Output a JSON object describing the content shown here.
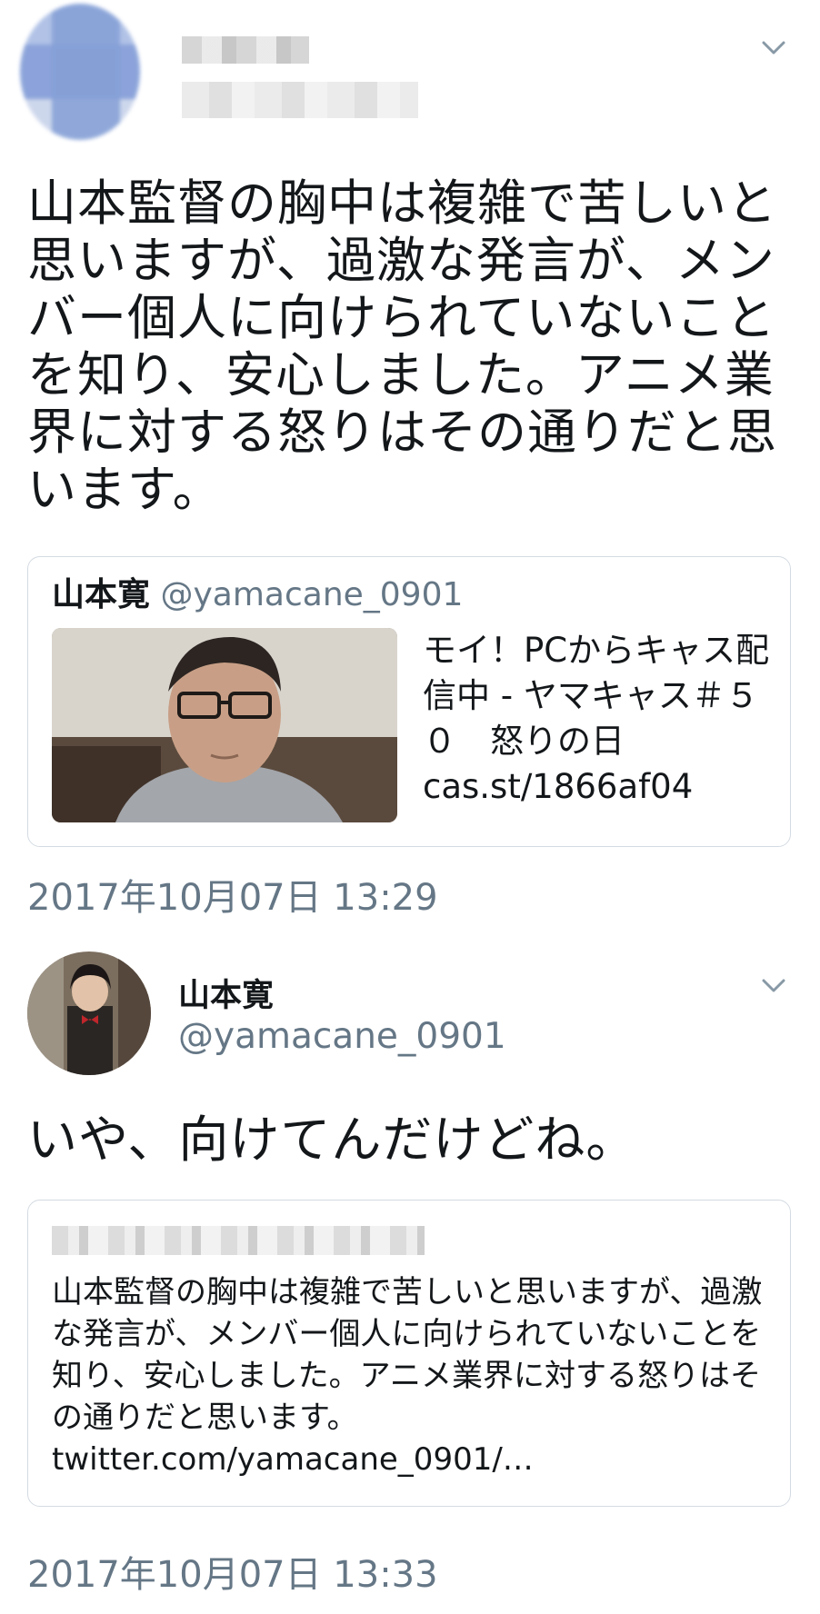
{
  "tweet1": {
    "text": "山本監督の胸中は複雑で苦しいと思いますが、過激な発言が、メンバー個人に向けられていないことを知り、安心しました。アニメ業界に対する怒りはその通りだと思います。",
    "quoted_card": {
      "author_name": "山本寛",
      "author_handle": "@yamacane_0901",
      "text": "モイ！PCからキャス配信中 - ヤマキャス＃５０　怒りの日 cas.st/1866af04"
    },
    "timestamp": "2017年10月07日 13:29"
  },
  "tweet2": {
    "author_name": "山本寛",
    "author_handle": "@yamacane_0901",
    "text": "いや、向けてんだけどね。",
    "quoted_card": {
      "text": "山本監督の胸中は複雑で苦しいと思いますが、過激な発言が、メンバー個人に向けられていないことを知り、安心しました。アニメ業界に対する怒りはその通りだと思います。twitter.com/yamacane_0901/…"
    },
    "timestamp": "2017年10月07日 13:33"
  },
  "icons": {
    "menu": "chevron-down-icon"
  },
  "colors": {
    "text": "#14171a",
    "secondary": "#657786",
    "border": "#d4dbe2"
  }
}
